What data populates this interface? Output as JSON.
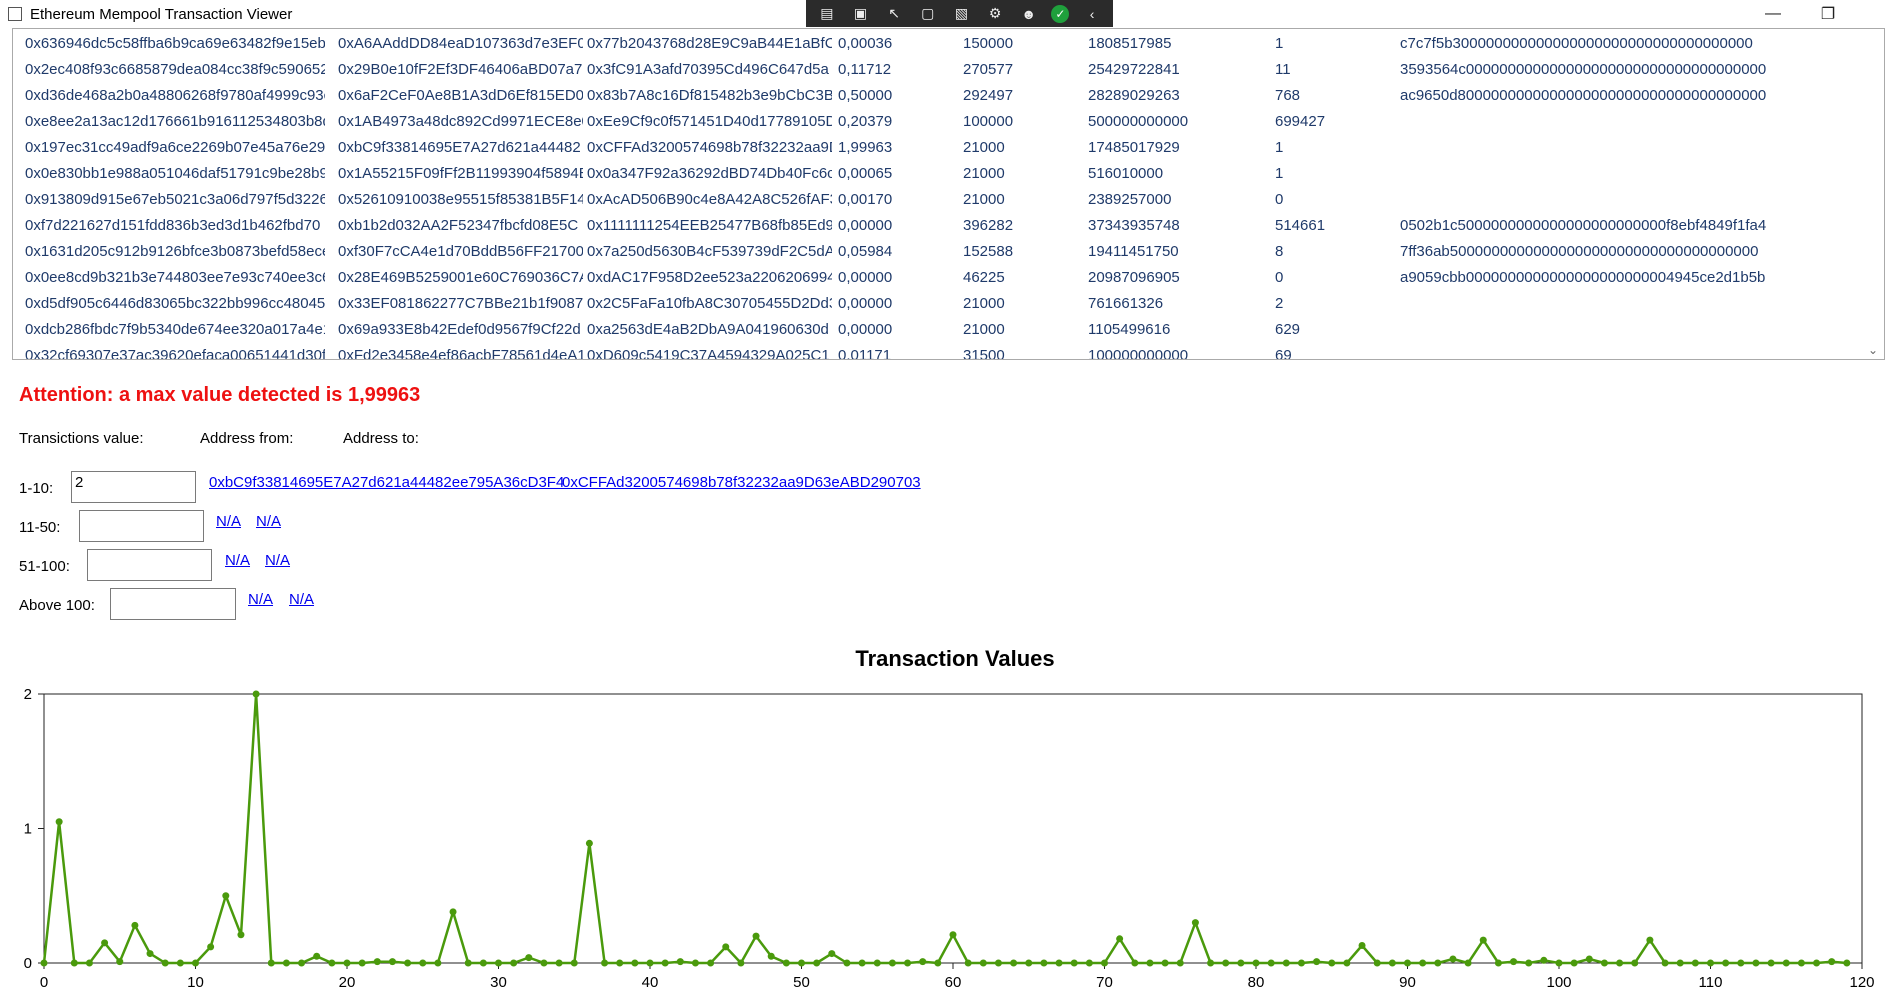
{
  "window": {
    "title": "Ethereum Mempool Transaction Viewer",
    "minimize_icon": "minimize-icon",
    "restore_icon": "restore-icon"
  },
  "toolbar": {
    "icons": [
      "live-visual-tree-icon",
      "record-icon",
      "select-element-icon",
      "display-layout-adorners-icon",
      "track-focus-icon",
      "binding-failures-icon",
      "accessibility-icon",
      "check-icon",
      "collapse-chevron-icon"
    ]
  },
  "grid": {
    "rows": [
      [
        "0x636946dc5c58ffba6b9ca69e63482f9e15eb0",
        "0xA6AAddDD84eaD107363d7e3EF0",
        "0x77b2043768d28E9C9aB44E1aBfC",
        "0,00036",
        "150000",
        "1808517985",
        "1",
        "c7c7f5b300000000000000000000000000000000000"
      ],
      [
        "0x2ec408f93c6685879dea084cc38f9c590652",
        "0x29B0e10fF2Ef3DF46406aBD07a78",
        "0x3fC91A3afd70395Cd496C647d5a",
        "0,11712",
        "270577",
        "25429722841",
        "11",
        "3593564c000000000000000000000000000000000000"
      ],
      [
        "0xd36de468a2b0a48806268f9780af4999c93c",
        "0x6aF2CeF0Ae8B1A3dD6Ef815ED0A",
        "0x83b7A8c16Df815482b3e9bCbC3Bb",
        "0,50000",
        "292497",
        "28289029263",
        "768",
        "ac9650d8000000000000000000000000000000000000"
      ],
      [
        "0xe8ee2a13ac12d176661b916112534803b8d",
        "0x1AB4973a48dc892Cd9971ECE8e0",
        "0xEe9Cf9c0f571451D40d17789105D",
        "0,20379",
        "100000",
        "500000000000",
        "699427",
        ""
      ],
      [
        "0x197ec31cc49adf9a6ce2269b07e45a76e29a",
        "0xbC9f33814695E7A27d621a44482",
        "0xCFFAd3200574698b78f32232aa9D",
        "1,99963",
        "21000",
        "17485017929",
        "1",
        ""
      ],
      [
        "0x0e830bb1e988a051046daf51791c9be28b9",
        "0x1A55215F09fFf2B11993904f5894E",
        "0x0a347F92a36292dBD74Db40Fc6c",
        "0,00065",
        "21000",
        "516010000",
        "1",
        ""
      ],
      [
        "0x913809d915e67eb5021c3a06d797f5d3226",
        "0x52610910038e95515f85381B5F14",
        "0xAcAD506B90c4e8A42A8C526fAF3",
        "0,00170",
        "21000",
        "2389257000",
        "0",
        ""
      ],
      [
        "0xf7d221627d151fdd836b3ed3d1b462fbd70",
        "0xb1b2d032AA2F52347fbcfd08E5C",
        "0x1111111254EEB25477B68fb85Ed9",
        "0,00000",
        "396282",
        "37343935748",
        "514661",
        "0502b1c5000000000000000000000000f8ebf4849f1fa4"
      ],
      [
        "0x1631d205c912b9126bfce3b0873befd58ece",
        "0xf30F7cCA4e1d70BddB56FF21700",
        "0x7a250d5630B4cF539739dF2C5dA",
        "0,05984",
        "152588",
        "19411451750",
        "8",
        "7ff36ab5000000000000000000000000000000000000"
      ],
      [
        "0x0ee8cd9b321b3e744803ee7e93c740ee3c6",
        "0x28E469B5259001e60C769036C7A",
        "0xdAC17F958D2ee523a2206206994",
        "0,00000",
        "46225",
        "20987096905",
        "0",
        "a9059cbb0000000000000000000000004945ce2d1b5b"
      ],
      [
        "0xd5df905c6446d83065bc322bb996cc48045",
        "0x33EF081862277C7BBe21b1f90872",
        "0x2C5FaFa10fbA8C30705455D2Dd3",
        "0,00000",
        "21000",
        "761661326",
        "2",
        ""
      ],
      [
        "0xdcb286fbdc7f9b5340de674ee320a017a4e1",
        "0x69a933E8b42Edef0d9567f9Cf22d",
        "0xa2563dE4aB2DbA9A041960630d",
        "0,00000",
        "21000",
        "1105499616",
        "629",
        ""
      ],
      [
        "0x32cf69307e37ac39620efaca00651441d30fa",
        "0xFd2e3458e4ef86acbF78561d4eA1",
        "0xD609c5419C37A4594329A025C1",
        "0,01171",
        "31500",
        "100000000000",
        "69",
        ""
      ]
    ],
    "scroll_icon": "chevron-down-icon"
  },
  "attention": "Attention: a max value detected is 1,99963",
  "labels": {
    "value": "Transictions value:",
    "from": "Address from:",
    "to": "Address to:"
  },
  "ranges": [
    {
      "label": "1-10:",
      "value": "2",
      "from": "0xbC9f33814695E7A27d621a44482ee795A36cD3F4",
      "to": "0xCFFAd3200574698b78f32232aa9D63eABD290703"
    },
    {
      "label": "11-50:",
      "value": "",
      "from": "N/A",
      "to": "N/A"
    },
    {
      "label": "51-100:",
      "value": "",
      "from": "N/A",
      "to": "N/A"
    },
    {
      "label": "Above 100:",
      "value": "",
      "from": "N/A",
      "to": "N/A"
    }
  ],
  "colors": {
    "attention": "#ee1111",
    "series": "#4a9a0c",
    "link": "#0000ee"
  },
  "chart_data": {
    "type": "line",
    "title": "Transaction Values",
    "xlabel": "",
    "ylabel": "",
    "xlim": [
      0,
      120
    ],
    "ylim": [
      0,
      2
    ],
    "xticks": [
      0,
      10,
      20,
      30,
      40,
      50,
      60,
      70,
      80,
      90,
      100,
      110,
      120
    ],
    "yticks": [
      0,
      1,
      2
    ],
    "grid": false,
    "x": [
      0,
      1,
      2,
      3,
      4,
      5,
      6,
      7,
      8,
      9,
      10,
      11,
      12,
      13,
      14,
      15,
      16,
      17,
      18,
      19,
      20,
      21,
      22,
      23,
      24,
      25,
      26,
      27,
      28,
      29,
      30,
      31,
      32,
      33,
      34,
      35,
      36,
      37,
      38,
      39,
      40,
      41,
      42,
      43,
      44,
      45,
      46,
      47,
      48,
      49,
      50,
      51,
      52,
      53,
      54,
      55,
      56,
      57,
      58,
      59,
      60,
      61,
      62,
      63,
      64,
      65,
      66,
      67,
      68,
      69,
      70,
      71,
      72,
      73,
      74,
      75,
      76,
      77,
      78,
      79,
      80,
      81,
      82,
      83,
      84,
      85,
      86,
      87,
      88,
      89,
      90,
      91,
      92,
      93,
      94,
      95,
      96,
      97,
      98,
      99,
      100,
      101,
      102,
      103,
      104,
      105,
      106,
      107,
      108,
      109,
      110,
      111,
      112,
      113,
      114,
      115,
      116,
      117,
      118,
      119
    ],
    "values": [
      0.0,
      1.05,
      0.0,
      0.0,
      0.15,
      0.01,
      0.28,
      0.07,
      0.0,
      0.0,
      0.0,
      0.12,
      0.5,
      0.21,
      2.0,
      0.0,
      0.0,
      0.0,
      0.05,
      0.0,
      0.0,
      0.0,
      0.01,
      0.01,
      0.0,
      0.0,
      0.0,
      0.38,
      0.0,
      0.0,
      0.0,
      0.0,
      0.04,
      0.0,
      0.0,
      0.0,
      0.89,
      0.0,
      0.0,
      0.0,
      0.0,
      0.0,
      0.01,
      0.0,
      0.0,
      0.12,
      0.0,
      0.2,
      0.05,
      0.0,
      0.0,
      0.0,
      0.07,
      0.0,
      0.0,
      0.0,
      0.0,
      0.0,
      0.01,
      0.0,
      0.21,
      0.0,
      0.0,
      0.0,
      0.0,
      0.0,
      0.0,
      0.0,
      0.0,
      0.0,
      0.0,
      0.18,
      0.0,
      0.0,
      0.0,
      0.0,
      0.3,
      0.0,
      0.0,
      0.0,
      0.0,
      0.0,
      0.0,
      0.0,
      0.01,
      0.0,
      0.0,
      0.13,
      0.0,
      0.0,
      0.0,
      0.0,
      0.0,
      0.03,
      0.0,
      0.17,
      0.0,
      0.01,
      0.0,
      0.02,
      0.0,
      0.0,
      0.03,
      0.0,
      0.0,
      0.0,
      0.17,
      0.0,
      0.0,
      0.0,
      0.0,
      0.0,
      0.0,
      0.0,
      0.0,
      0.0,
      0.0,
      0.0,
      0.01,
      0.0
    ]
  }
}
